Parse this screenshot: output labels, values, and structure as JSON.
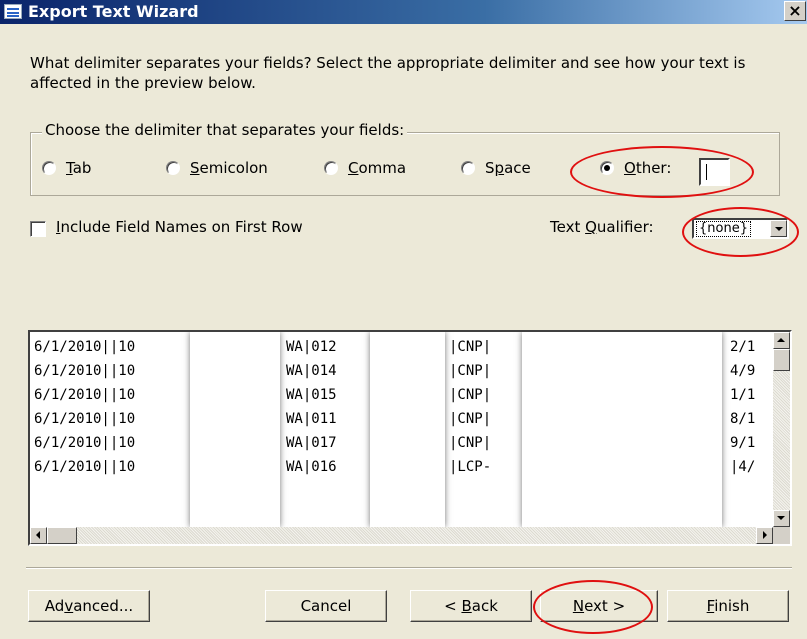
{
  "window": {
    "title": "Export Text Wizard",
    "close_glyph": "×"
  },
  "prompt": "What delimiter separates your fields? Select the appropriate delimiter and see how your text is affected in the preview below.",
  "delimiter_group": {
    "legend": "Choose the delimiter that separates your fields:",
    "options": [
      {
        "access_key": "T",
        "rest": "ab",
        "checked": false
      },
      {
        "access_key": "S",
        "rest": "emicolon",
        "checked": false
      },
      {
        "access_key": "C",
        "rest": "omma",
        "checked": false
      },
      {
        "prefix": "S",
        "access_key": "p",
        "rest": "ace",
        "checked": false
      },
      {
        "access_key": "O",
        "rest": "ther:",
        "checked": true
      }
    ],
    "other_value": ""
  },
  "include_field_names": {
    "access_key": "I",
    "rest": "nclude Field Names on First Row",
    "checked": false
  },
  "text_qualifier": {
    "prefix": "Text ",
    "access_key": "Q",
    "rest": "ualifier:",
    "value": "{none}"
  },
  "preview": {
    "rows": [
      [
        "6/1/2010||10",
        "WA|012",
        "|CNP|",
        "2/1"
      ],
      [
        "6/1/2010||10",
        "WA|014",
        "|CNP|",
        "4/9"
      ],
      [
        "6/1/2010||10",
        "WA|015",
        "|CNP|",
        "1/1"
      ],
      [
        "6/1/2010||10",
        "WA|011",
        "|CNP|",
        "8/1"
      ],
      [
        "6/1/2010||10",
        "WA|017",
        "|CNP|",
        "9/1"
      ],
      [
        "6/1/2010||10",
        "WA|016",
        "|LCP-",
        "|4/"
      ]
    ]
  },
  "buttons": {
    "advanced": {
      "prefix": "Ad",
      "access_key": "v",
      "rest": "anced..."
    },
    "cancel": {
      "label": "Cancel"
    },
    "back": {
      "prefix": "< ",
      "access_key": "B",
      "rest": "ack"
    },
    "next": {
      "access_key": "N",
      "rest": "ext >"
    },
    "finish": {
      "access_key": "F",
      "rest": "inish"
    }
  },
  "colors": {
    "titlebar": "#0a246a",
    "dialog": "#ece9d8",
    "annotation": "#e01010"
  }
}
